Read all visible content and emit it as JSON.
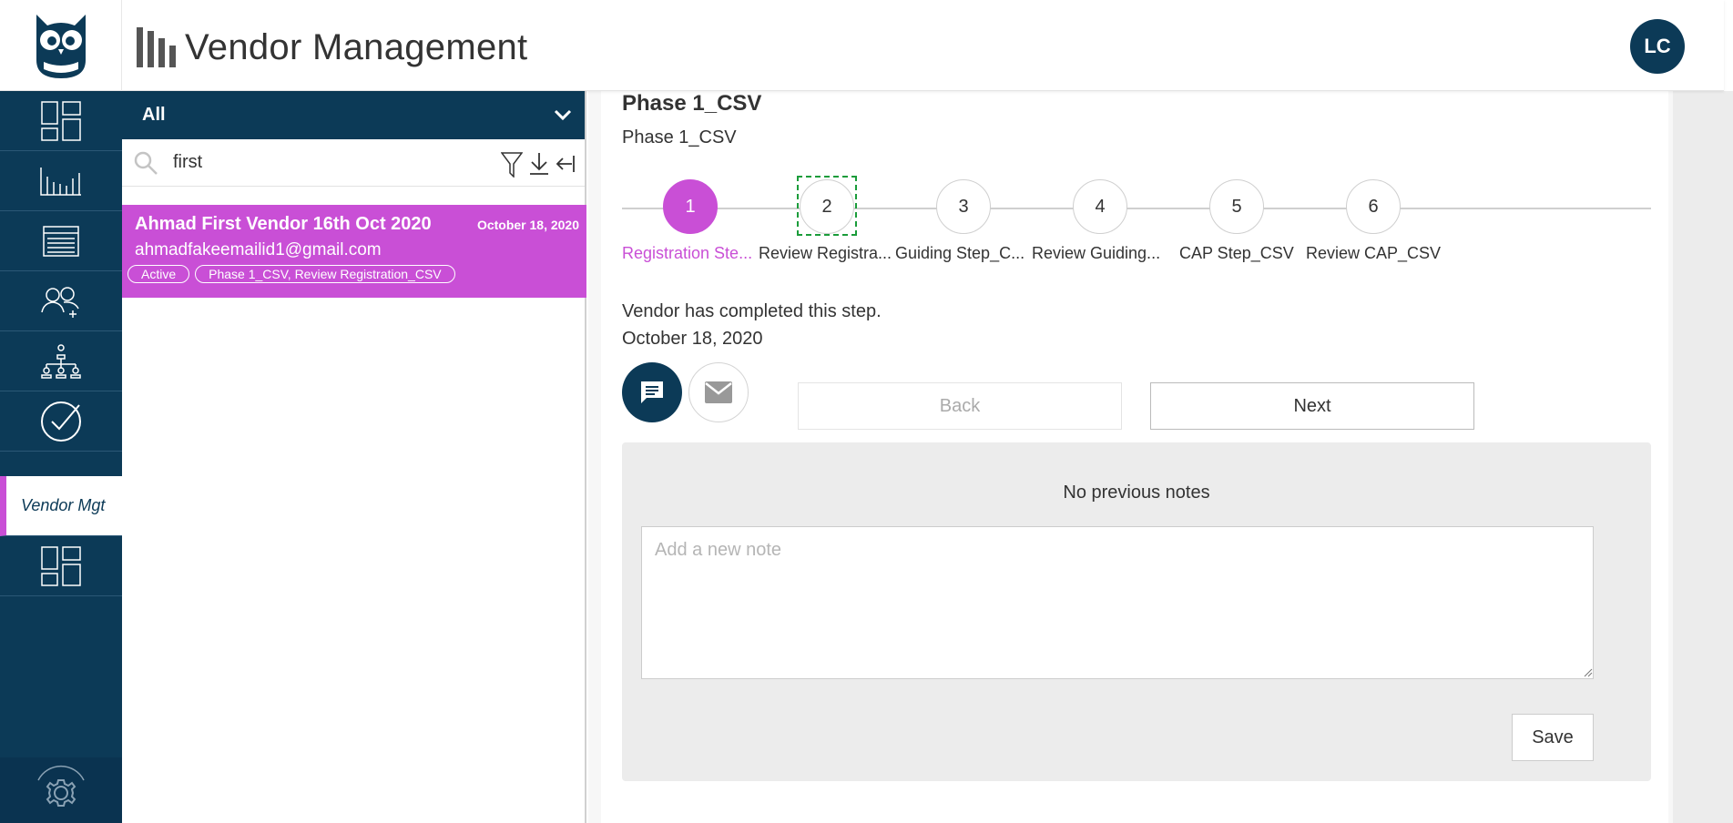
{
  "header": {
    "app_title": "Vendor Management",
    "avatar_initials": "LC"
  },
  "nav": {
    "active_label": "Vendor Mgt",
    "items": [
      "dashboard-icon",
      "bar-chart-icon",
      "table-icon",
      "users-add-icon",
      "org-chart-icon",
      "check-circle-icon",
      "vendor-mgt",
      "dashboard-icon",
      "settings-icon"
    ]
  },
  "list": {
    "filter_label": "All",
    "search_value": "first",
    "vendor": {
      "name": "Ahmad First Vendor 16th Oct 2020",
      "date": "October 18, 2020",
      "email": "ahmadfakeemailid1@gmail.com",
      "tags": [
        "Active",
        "Phase 1_CSV, Review Registration_CSV"
      ]
    }
  },
  "main": {
    "phase_title": "Phase 1_CSV",
    "phase_subtitle": "Phase 1_CSV",
    "steps": [
      {
        "number": "1",
        "label": "Registration Ste..."
      },
      {
        "number": "2",
        "label": "Review Registra..."
      },
      {
        "number": "3",
        "label": "Guiding Step_C..."
      },
      {
        "number": "4",
        "label": "Review Guiding..."
      },
      {
        "number": "5",
        "label": "CAP Step_CSV"
      },
      {
        "number": "6",
        "label": "Review CAP_CSV"
      }
    ],
    "completed_step": "1",
    "status_line1": "Vendor has completed this step.",
    "status_line2": "October 18, 2020",
    "back_label": "Back",
    "next_label": "Next",
    "notes": {
      "empty_text": "No previous notes",
      "placeholder": "Add a new note",
      "save_label": "Save"
    }
  },
  "colors": {
    "navy": "#0c3a57",
    "accent": "#c94fd6"
  }
}
